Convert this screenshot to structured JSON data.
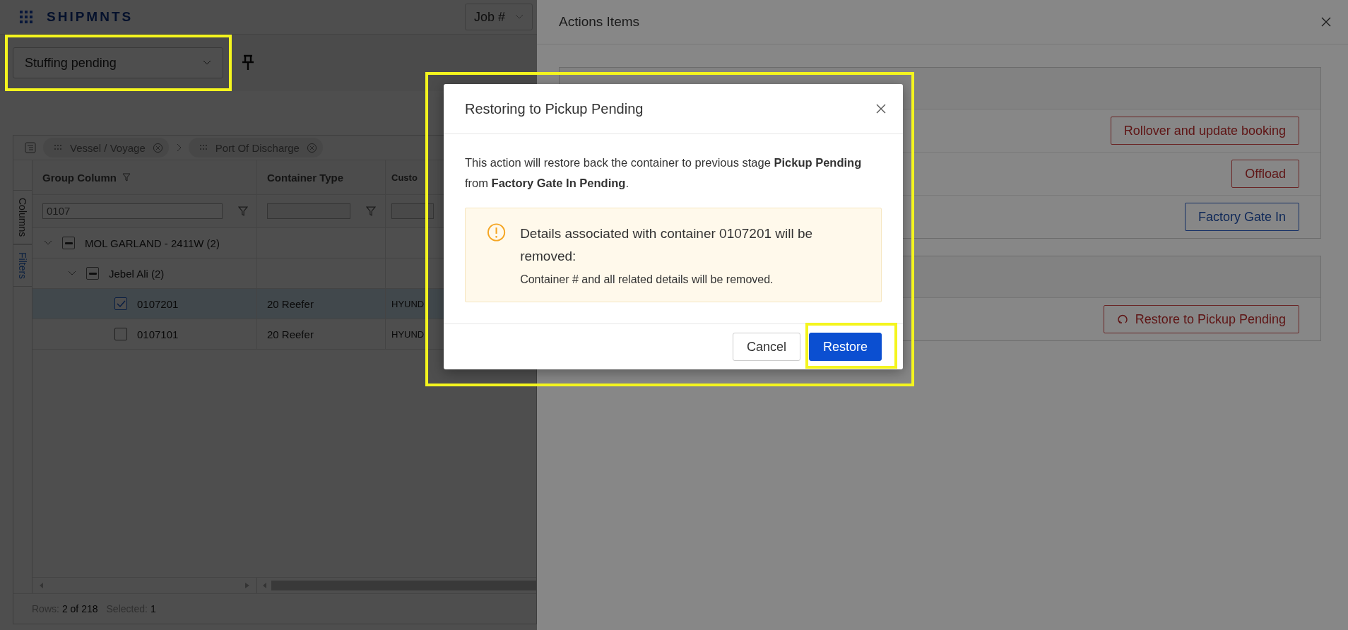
{
  "app": {
    "brand": "SHIPMNTS",
    "job_select": "Job #",
    "stage_select": "Stuffing pending"
  },
  "grid": {
    "group_chips": [
      "Vessel / Voyage",
      "Port Of Discharge"
    ],
    "side_tabs": [
      {
        "label": "Columns",
        "selected": false
      },
      {
        "label": "Filters",
        "selected": true
      }
    ],
    "columns": [
      "Group Column",
      "Container Type",
      "Custo"
    ],
    "group_filter": "0107",
    "tree": [
      {
        "label": "MOL GARLAND - 2411W (2)",
        "expanded": true,
        "indeterminate": true,
        "children": [
          {
            "label": "Jebel Ali (2)",
            "expanded": true,
            "indeterminate": true,
            "children": [
              {
                "container": "0107201",
                "type": "20 Reefer",
                "customer": "HYUND",
                "checked": true,
                "selected": true
              },
              {
                "container": "0107101",
                "type": "20 Reefer",
                "customer": "HYUND",
                "checked": false,
                "selected": false
              }
            ]
          }
        ]
      }
    ],
    "status_bar": {
      "rows_label": "Rows:",
      "rows_value": "2 of 218",
      "selected_label": "Selected:",
      "selected_value": "1"
    }
  },
  "panel": {
    "title": "Actions Items",
    "sections": [
      {
        "actions": [
          {
            "label": "Rollover and update booking",
            "kind": "danger"
          },
          {
            "label": "Offload",
            "kind": "danger"
          },
          {
            "label": "Factory Gate In",
            "kind": "primary"
          }
        ]
      },
      {
        "actions": [
          {
            "label": "Restore to Pickup Pending",
            "kind": "restore"
          }
        ]
      }
    ]
  },
  "dialog": {
    "title": "Restoring to Pickup Pending",
    "message": "This action will restore back the container to previous stage **Pickup Pending** from **Factory Gate In Pending**.",
    "alert_title": "Details associated with container 0107201 will be removed:",
    "alert_text": "Container # and all related details will be removed.",
    "buttons": [
      {
        "label": "Cancel",
        "kind": "secondary"
      },
      {
        "label": "Restore",
        "kind": "primary"
      }
    ]
  }
}
